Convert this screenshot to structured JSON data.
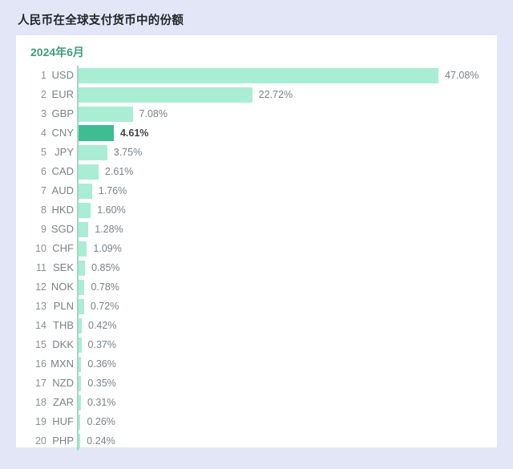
{
  "page": {
    "title": "人民币在全球支付货币中的份额",
    "background_color": "#e2e6f7"
  },
  "card": {
    "subtitle": "2024年6月",
    "subtitle_color": "#3e9e7c",
    "background_color": "#ffffff"
  },
  "colors": {
    "bar": "#a9edd4",
    "bar_highlight": "#3fbd92",
    "axis": "#9fd9c1",
    "label": "#7b8288"
  },
  "chart_data": {
    "type": "bar",
    "orientation": "horizontal",
    "title": "人民币在全球支付货币中的份额",
    "subtitle": "2024年6月",
    "xlabel": "",
    "ylabel": "",
    "xlim": [
      0,
      47.08
    ],
    "grid": false,
    "legend": false,
    "highlight_category": "CNY",
    "value_suffix": "%",
    "categories": [
      "USD",
      "EUR",
      "GBP",
      "CNY",
      "JPY",
      "CAD",
      "AUD",
      "HKD",
      "SGD",
      "CHF",
      "SEK",
      "NOK",
      "PLN",
      "THB",
      "DKK",
      "MXN",
      "NZD",
      "ZAR",
      "HUF",
      "PHP"
    ],
    "values": [
      47.08,
      22.72,
      7.08,
      4.61,
      3.75,
      2.61,
      1.76,
      1.6,
      1.28,
      1.09,
      0.85,
      0.78,
      0.72,
      0.42,
      0.37,
      0.36,
      0.35,
      0.31,
      0.26,
      0.24
    ],
    "rows": [
      {
        "rank": "1",
        "code": "USD",
        "value": 47.08,
        "label": "47.08%",
        "highlight": false
      },
      {
        "rank": "2",
        "code": "EUR",
        "value": 22.72,
        "label": "22.72%",
        "highlight": false
      },
      {
        "rank": "3",
        "code": "GBP",
        "value": 7.08,
        "label": "7.08%",
        "highlight": false
      },
      {
        "rank": "4",
        "code": "CNY",
        "value": 4.61,
        "label": "4.61%",
        "highlight": true
      },
      {
        "rank": "5",
        "code": "JPY",
        "value": 3.75,
        "label": "3.75%",
        "highlight": false
      },
      {
        "rank": "6",
        "code": "CAD",
        "value": 2.61,
        "label": "2.61%",
        "highlight": false
      },
      {
        "rank": "7",
        "code": "AUD",
        "value": 1.76,
        "label": "1.76%",
        "highlight": false
      },
      {
        "rank": "8",
        "code": "HKD",
        "value": 1.6,
        "label": "1.60%",
        "highlight": false
      },
      {
        "rank": "9",
        "code": "SGD",
        "value": 1.28,
        "label": "1.28%",
        "highlight": false
      },
      {
        "rank": "10",
        "code": "CHF",
        "value": 1.09,
        "label": "1.09%",
        "highlight": false
      },
      {
        "rank": "11",
        "code": "SEK",
        "value": 0.85,
        "label": "0.85%",
        "highlight": false
      },
      {
        "rank": "12",
        "code": "NOK",
        "value": 0.78,
        "label": "0.78%",
        "highlight": false
      },
      {
        "rank": "13",
        "code": "PLN",
        "value": 0.72,
        "label": "0.72%",
        "highlight": false
      },
      {
        "rank": "14",
        "code": "THB",
        "value": 0.42,
        "label": "0.42%",
        "highlight": false
      },
      {
        "rank": "15",
        "code": "DKK",
        "value": 0.37,
        "label": "0.37%",
        "highlight": false
      },
      {
        "rank": "16",
        "code": "MXN",
        "value": 0.36,
        "label": "0.36%",
        "highlight": false
      },
      {
        "rank": "17",
        "code": "NZD",
        "value": 0.35,
        "label": "0.35%",
        "highlight": false
      },
      {
        "rank": "18",
        "code": "ZAR",
        "value": 0.31,
        "label": "0.31%",
        "highlight": false
      },
      {
        "rank": "19",
        "code": "HUF",
        "value": 0.26,
        "label": "0.26%",
        "highlight": false
      },
      {
        "rank": "20",
        "code": "PHP",
        "value": 0.24,
        "label": "0.24%",
        "highlight": false
      }
    ]
  }
}
